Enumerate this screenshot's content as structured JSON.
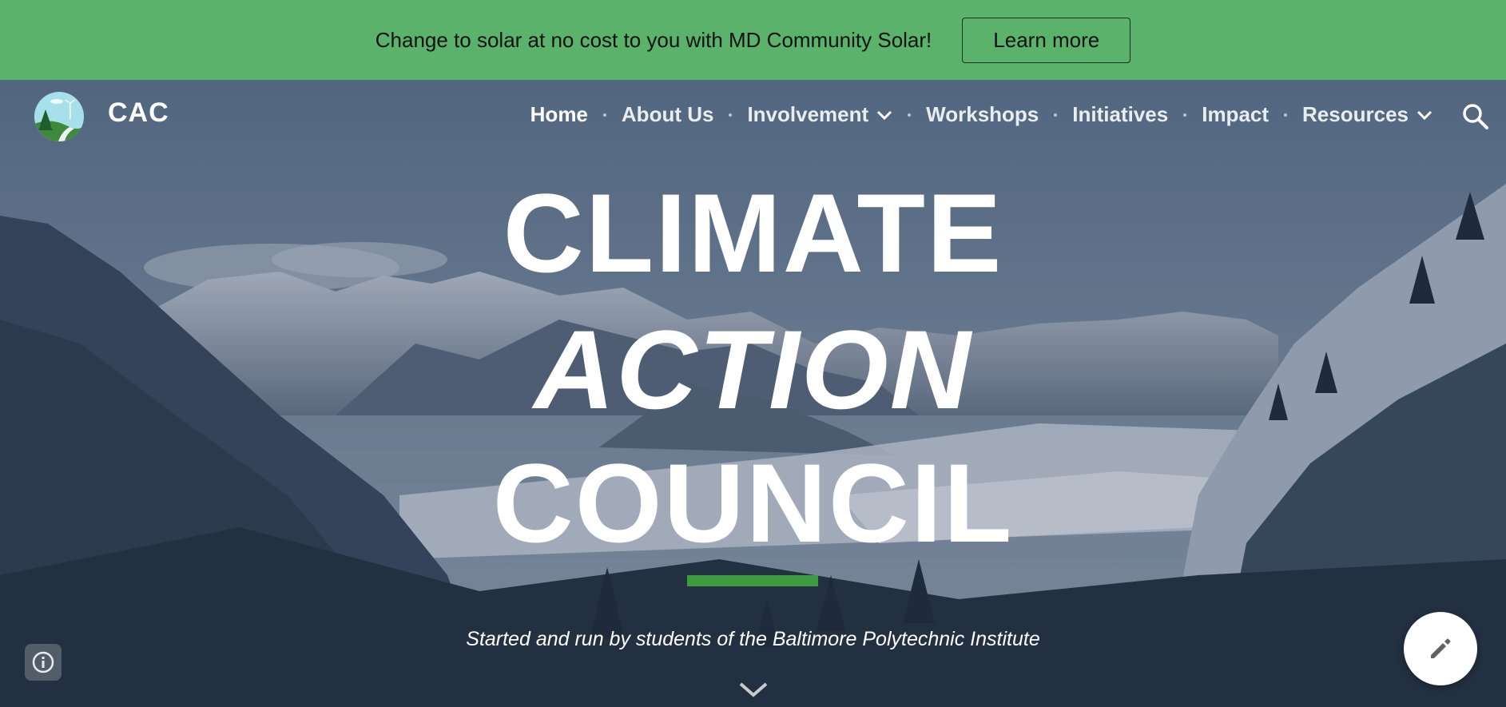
{
  "banner": {
    "text": "Change to solar at no cost to you with MD Community Solar!",
    "button_label": "Learn more",
    "color": "#5bb26a"
  },
  "header": {
    "site_title": "CAC",
    "logo_icon": "globe-landscape-logo",
    "nav": [
      {
        "label": "Home",
        "active": true,
        "dropdown": false
      },
      {
        "label": "About Us",
        "active": false,
        "dropdown": false
      },
      {
        "label": "Involvement",
        "active": false,
        "dropdown": true
      },
      {
        "label": "Workshops",
        "active": false,
        "dropdown": false
      },
      {
        "label": "Initiatives",
        "active": false,
        "dropdown": false
      },
      {
        "label": "Impact",
        "active": false,
        "dropdown": false
      },
      {
        "label": "Resources",
        "active": false,
        "dropdown": true
      }
    ],
    "search_icon": "search-icon"
  },
  "hero": {
    "title_line1": "CLIMATE",
    "title_line2": "ACTION",
    "title_line3": "COUNCIL",
    "subtitle": "Started and run by students of the Baltimore Polytechnic Institute",
    "accent_color": "#3c9a3f",
    "scroll_icon": "chevron-down-icon"
  },
  "floating": {
    "info_icon": "info-icon",
    "edit_icon": "pencil-icon"
  }
}
